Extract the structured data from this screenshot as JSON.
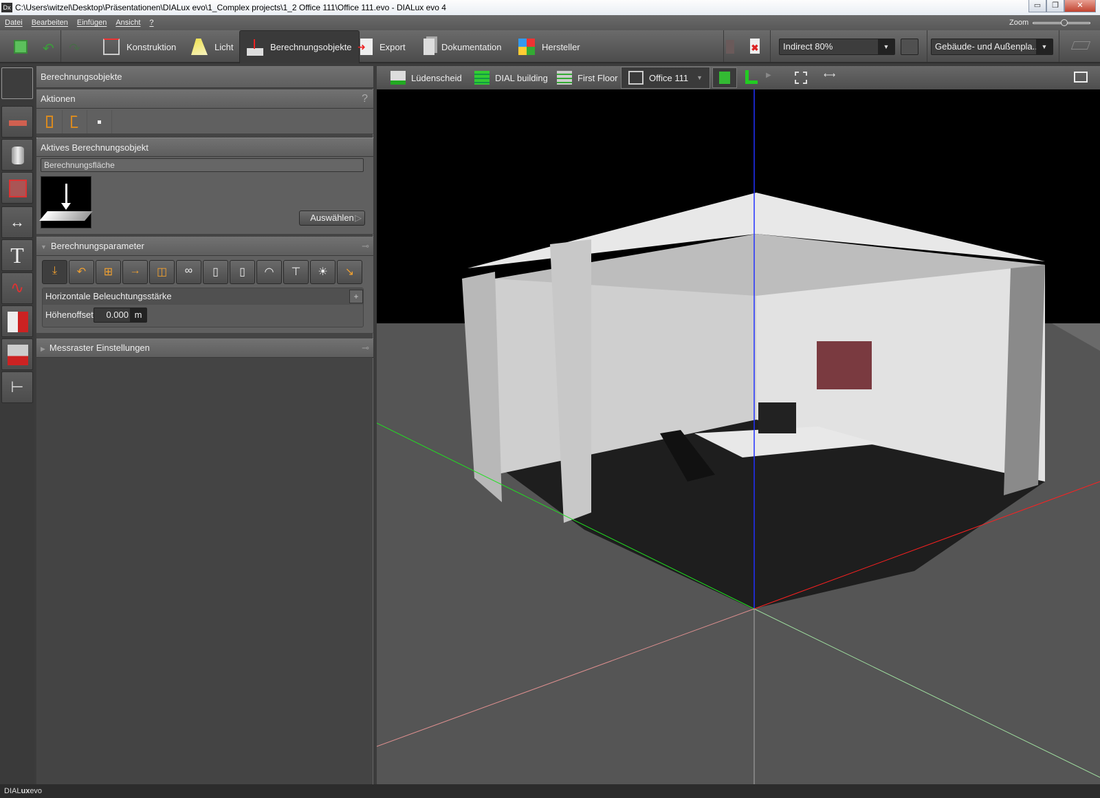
{
  "window": {
    "title": "C:\\Users\\witzel\\Desktop\\Präsentationen\\DIALux evo\\1_Complex projects\\1_2 Office 111\\Office 111.evo - DIALux evo 4",
    "logo": "Dx"
  },
  "menu": [
    "Datei",
    "Bearbeiten",
    "Einfügen",
    "Ansicht",
    "?"
  ],
  "zoom": {
    "label": "Zoom",
    "value": 0.5
  },
  "toolbar": {
    "tabs": [
      {
        "label": "Konstruktion",
        "icon": "construction-box-icon"
      },
      {
        "label": "Licht",
        "icon": "light-cone-icon"
      },
      {
        "label": "Berechnungsobjekte",
        "icon": "calc-surface-icon",
        "active": true
      },
      {
        "label": "Export",
        "icon": "export-icon"
      },
      {
        "label": "Dokumentation",
        "icon": "documents-icon"
      },
      {
        "label": "Hersteller",
        "icon": "manufacturer-catalog-icon"
      }
    ],
    "light_scene": "Indirect 80%",
    "view_mode": "Gebäude- und Außenpla..."
  },
  "panel": {
    "title": "Berechnungsobjekte",
    "actions": "Aktionen",
    "help": "?",
    "active_object": {
      "header": "Aktives Berechnungsobjekt",
      "name": "Berechnungsfläche",
      "select_button": "Auswählen"
    },
    "params": {
      "header": "Berechnungsparameter",
      "type": "Horizontale Beleuchtungsstärke",
      "height_offset_label": "Höhenoffset",
      "height_offset_value": "0.000",
      "unit": "m"
    },
    "grid": {
      "header": "Messraster Einstellungen"
    }
  },
  "viewport": {
    "breadcrumb": [
      "Lüdenscheid",
      "DIAL building",
      "First Floor",
      "Office 111"
    ],
    "colors": {
      "x_axis": "#ff2020",
      "y_axis": "#20e020",
      "z_axis": "#2030ff"
    }
  },
  "status": {
    "brand_a": "DIAL",
    "brand_b": "ux",
    "brand_c": "evo"
  }
}
